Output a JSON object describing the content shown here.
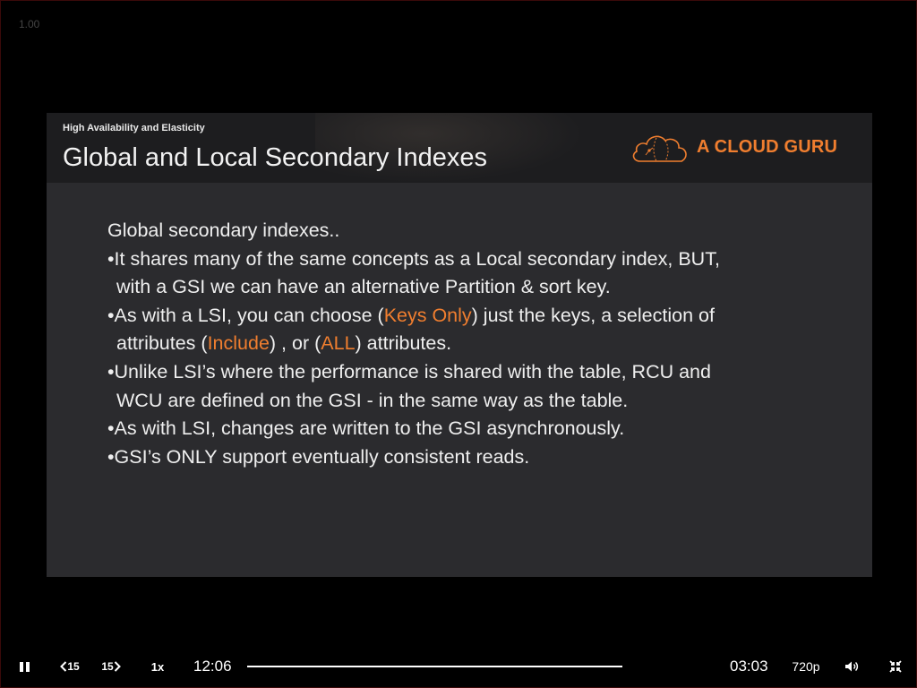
{
  "player": {
    "speed_indicator": "1.00",
    "controls": {
      "rewind_label": "15",
      "forward_label": "15",
      "speed_label": "1x",
      "current_time": "12:06",
      "remaining_time": "03:03",
      "quality_label": "720p",
      "progress": 1.0
    }
  },
  "slide": {
    "section_label": "High Availability and Elasticity",
    "title": "Global and Local Secondary Indexes",
    "logo_text": "A CLOUD GURU",
    "accent_color": "#f07e2f",
    "body": {
      "intro": "Global secondary indexes..",
      "b1_l1": "•It shares many of the same concepts as a Local secondary index, BUT,",
      "b1_l2": "with a GSI we can have an alternative Partition & sort key.",
      "b2_l1_a": "•As with a LSI, you can choose (",
      "b2_l1_hl": "Keys Only",
      "b2_l1_b": ") just the keys, a selection of",
      "b2_l2_a": "attributes (",
      "b2_l2_hl1": "Include",
      "b2_l2_b": ") , or (",
      "b2_l2_hl2": "ALL",
      "b2_l2_c": ") attributes.",
      "b3_l1": "•Unlike LSI’s where the performance is shared with the table, RCU and",
      "b3_l2": "WCU are defined on the GSI - in the same way as the table.",
      "b4": "•As with LSI, changes are written to the GSI asynchronously.",
      "b5": "•GSI’s ONLY support eventually consistent reads."
    }
  }
}
